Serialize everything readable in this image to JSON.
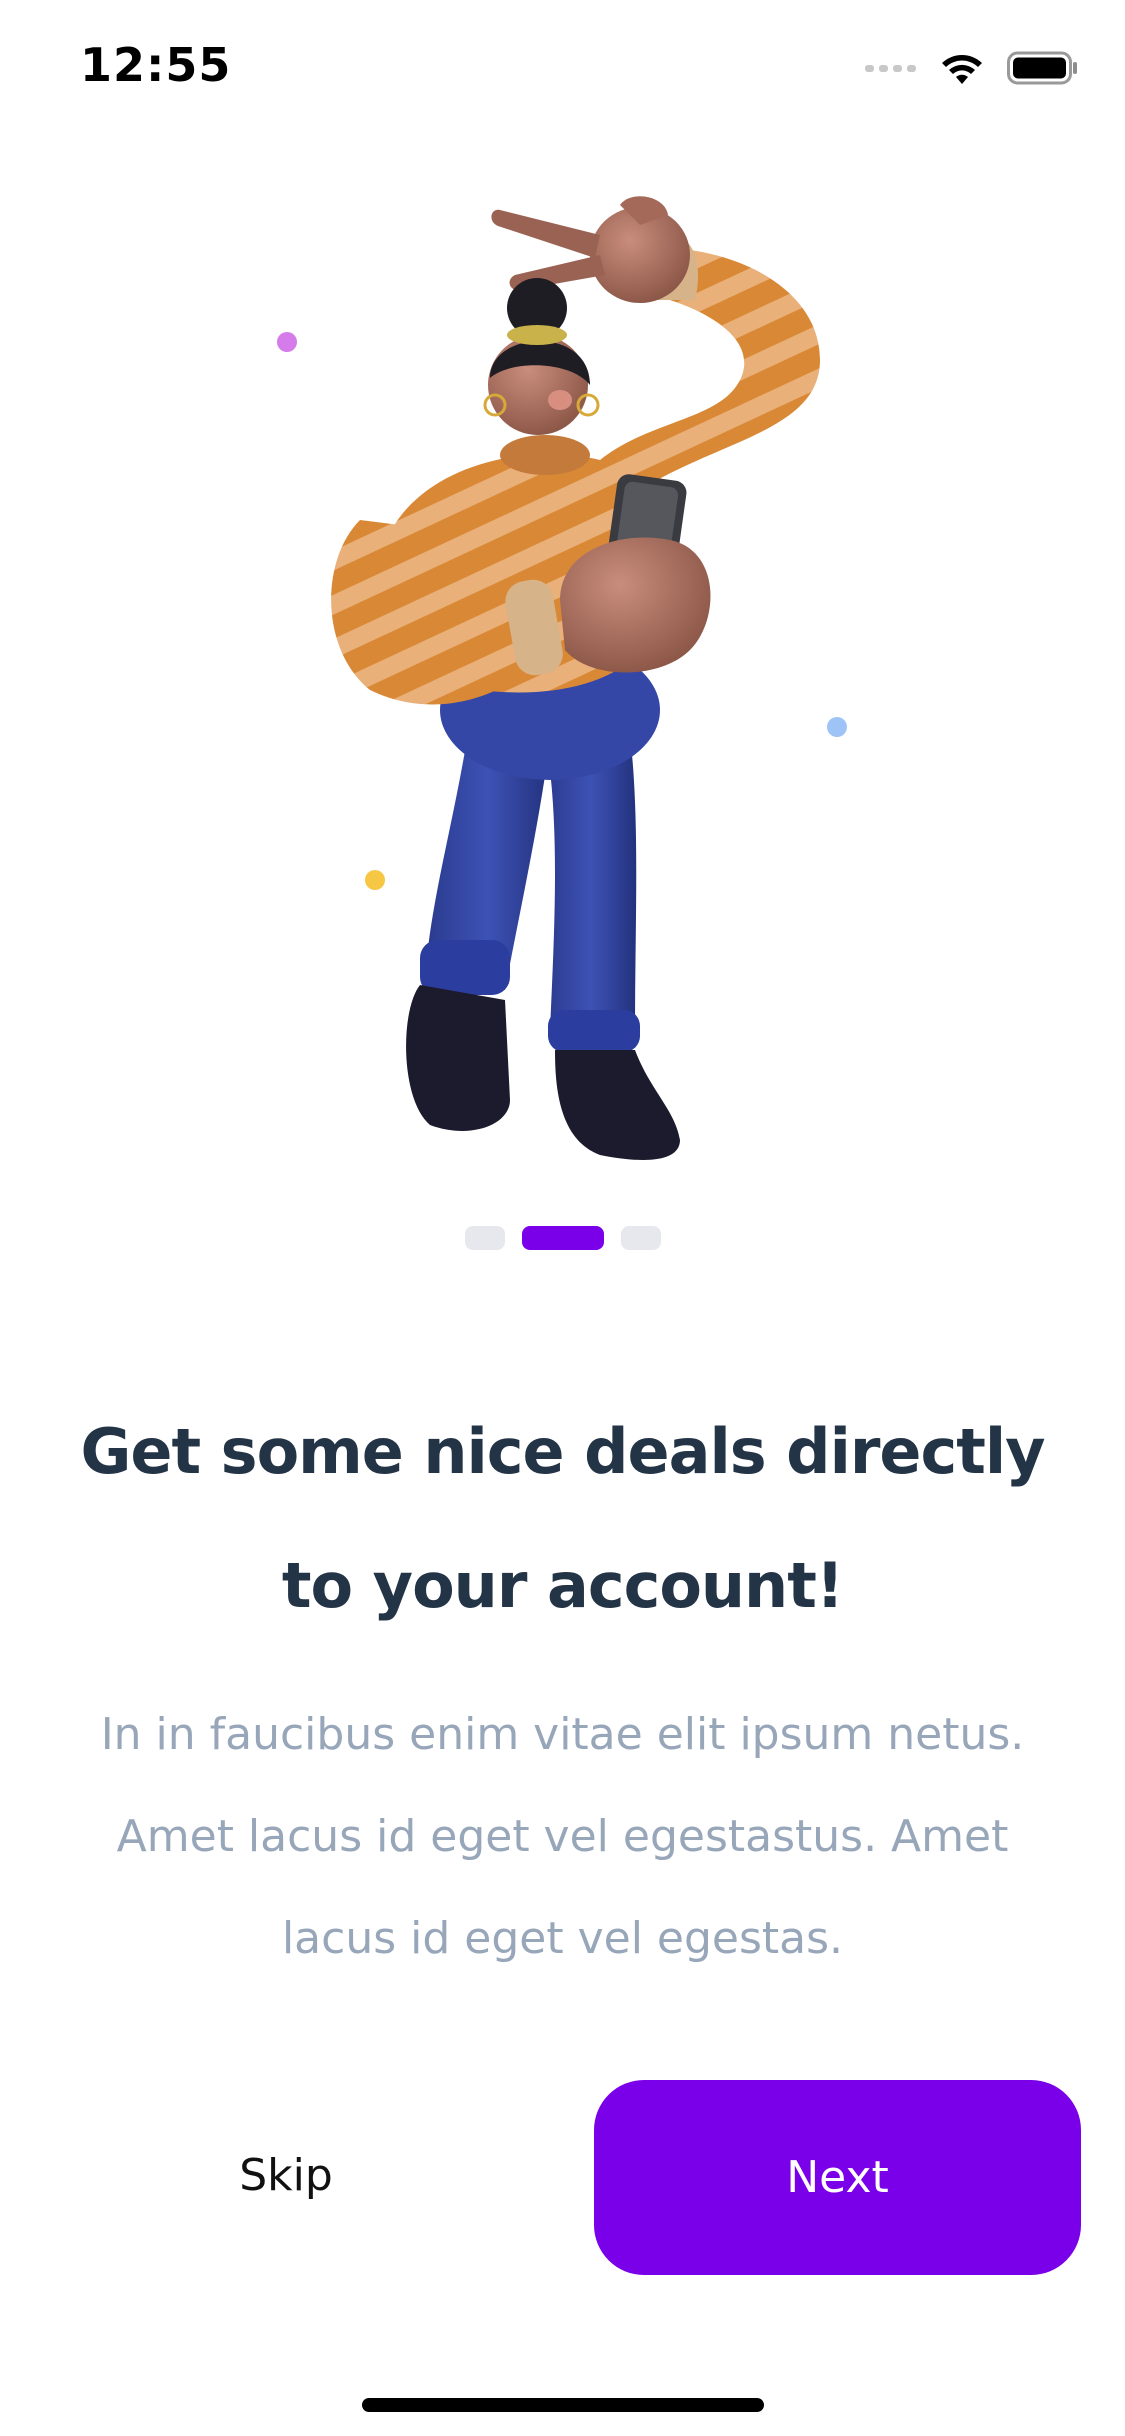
{
  "status_bar": {
    "time": "12:55",
    "icons": [
      "signal-icon",
      "wifi-icon",
      "battery-icon"
    ]
  },
  "hero": {
    "illustration": "woman-taking-selfie-illustration",
    "confetti_colors": [
      "#d57bea",
      "#9ec3f7",
      "#f5c744"
    ]
  },
  "pagination": {
    "pages": 3,
    "active_index": 1,
    "active_color": "#7a00ea",
    "inactive_color": "#e6e8ee"
  },
  "content": {
    "title": "Get some nice deals directly to your account!",
    "description": "In in faucibus enim vitae elit ipsum netus. Amet lacus id eget vel egestastus. Amet lacus id eget vel egestas."
  },
  "actions": {
    "skip_label": "Skip",
    "next_label": "Next"
  },
  "colors": {
    "accent": "#7a00ea",
    "title": "#243447",
    "body": "#97a6b9"
  }
}
